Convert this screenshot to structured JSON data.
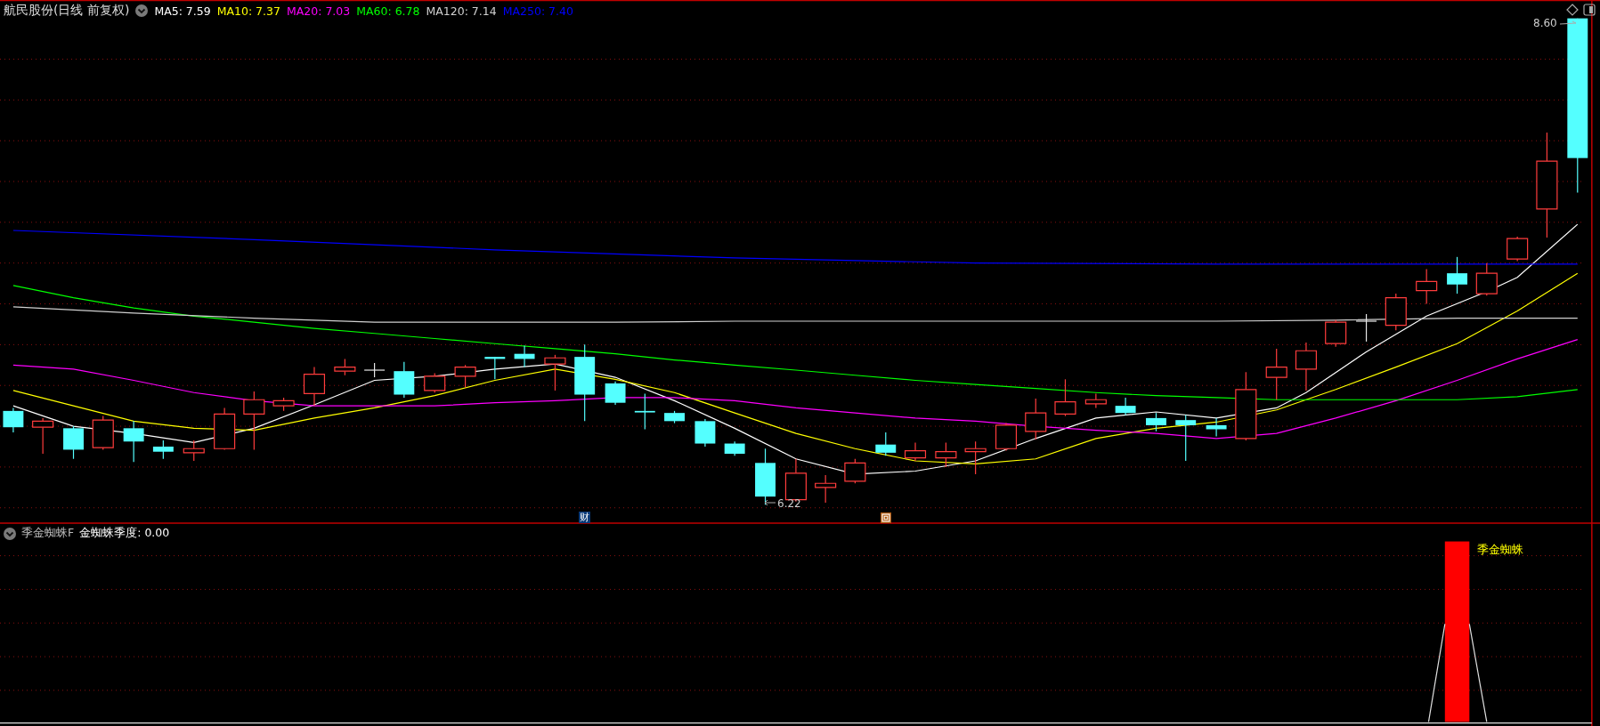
{
  "chart_title": "航民股份(日线 前复权)",
  "ma_legend": [
    {
      "label": "MA5: 7.59",
      "color": "#ffffff"
    },
    {
      "label": "MA10: 7.37",
      "color": "#ffff00"
    },
    {
      "label": "MA20: 7.03",
      "color": "#ff00ff"
    },
    {
      "label": "MA60: 6.78",
      "color": "#00ff00"
    },
    {
      "label": "MA120: 7.14",
      "color": "#d0d0d0"
    },
    {
      "label": "MA250: 7.40",
      "color": "#0000ff"
    }
  ],
  "high_label": "8.60",
  "low_label": "6.22",
  "finance_badge": "财",
  "indicator": {
    "name": "季金蜘蛛F",
    "reading": "金蜘蛛季度: 0.00",
    "signal_label": "季金蜘蛛"
  }
}
